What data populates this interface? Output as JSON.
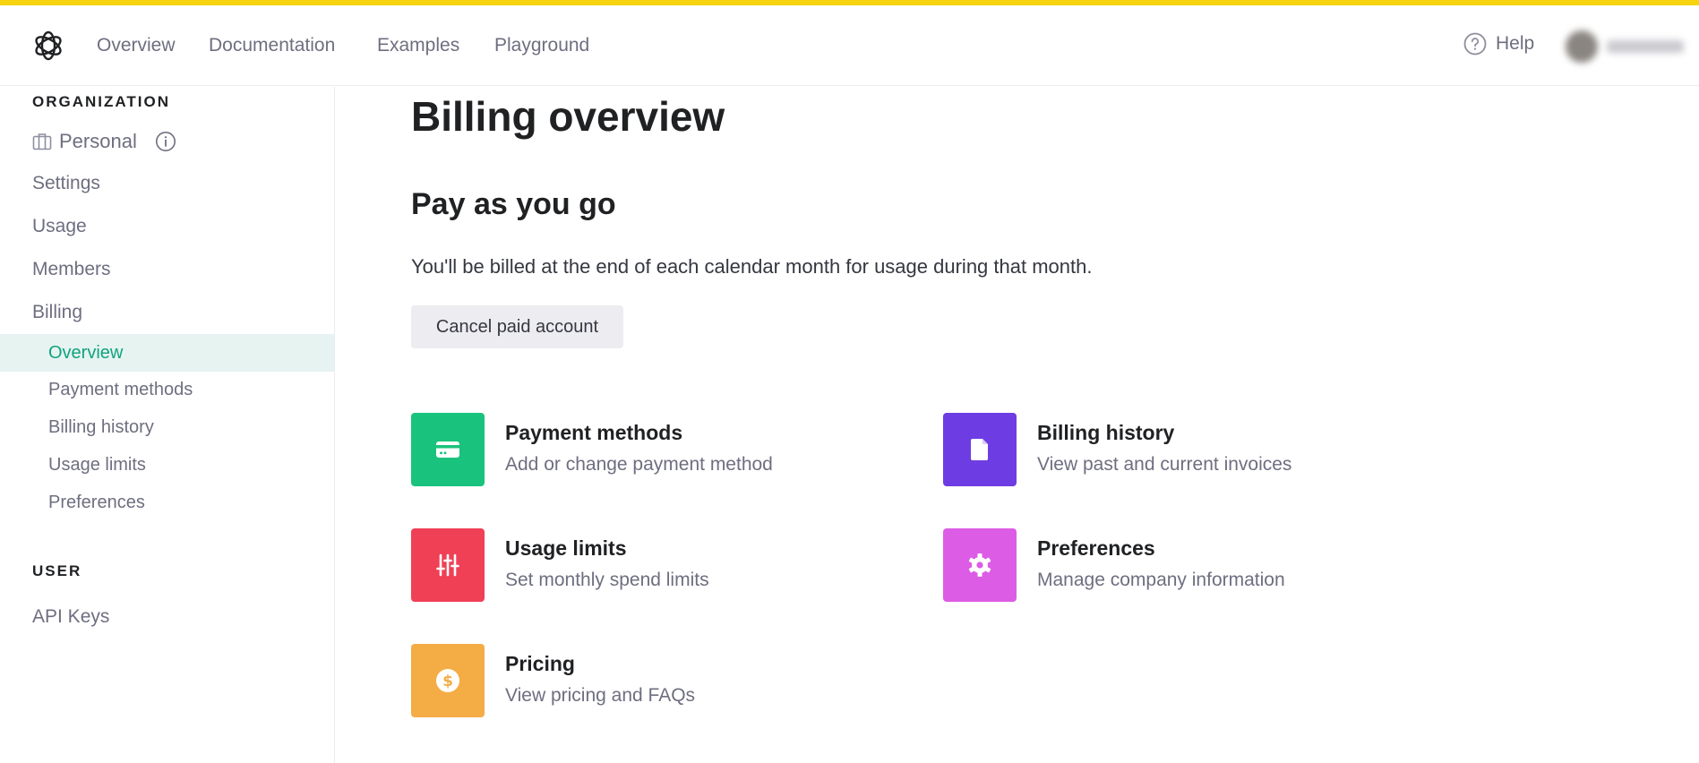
{
  "nav": {
    "links": [
      "Overview",
      "Documentation",
      "Examples",
      "Playground"
    ],
    "help_label": "Help"
  },
  "sidebar": {
    "org_label": "ORGANIZATION",
    "personal_label": "Personal",
    "items": [
      "Settings",
      "Usage",
      "Members",
      "Billing"
    ],
    "billing_sub": [
      "Overview",
      "Payment methods",
      "Billing history",
      "Usage limits",
      "Preferences"
    ],
    "active_sub": "Overview",
    "user_label": "USER",
    "user_items": [
      "API Keys"
    ]
  },
  "main": {
    "title": "Billing overview",
    "plan_title": "Pay as you go",
    "plan_description": "You'll be billed at the end of each calendar month for usage during that month.",
    "cancel_button": "Cancel paid account",
    "cards": [
      {
        "title": "Payment methods",
        "subtitle": "Add or change payment method",
        "icon": "credit-card-icon",
        "color": "#19c37d"
      },
      {
        "title": "Billing history",
        "subtitle": "View past and current invoices",
        "icon": "document-icon",
        "color": "#6e3ce3"
      },
      {
        "title": "Usage limits",
        "subtitle": "Set monthly spend limits",
        "icon": "sliders-icon",
        "color": "#ef4056"
      },
      {
        "title": "Preferences",
        "subtitle": "Manage company information",
        "icon": "gear-icon",
        "color": "#dd5ce5"
      },
      {
        "title": "Pricing",
        "subtitle": "View pricing and FAQs",
        "icon": "dollar-icon",
        "color": "#f4ac45"
      }
    ]
  },
  "colors": {
    "accent": "#10a37f",
    "active_bg": "#e6f3f1",
    "top_strip": "#f5d40f"
  }
}
